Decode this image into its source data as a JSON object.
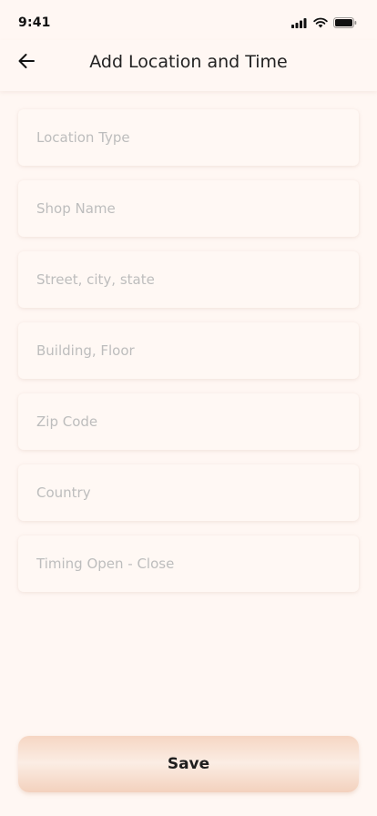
{
  "status_bar": {
    "time": "9:41",
    "icons": [
      "signal-icon",
      "wifi-icon",
      "battery-icon"
    ]
  },
  "header": {
    "title": "Add Location and Time",
    "back_icon": "arrow-left-icon"
  },
  "form": {
    "fields": [
      {
        "name": "location-type",
        "placeholder": "Location Type",
        "value": ""
      },
      {
        "name": "shop-name",
        "placeholder": "Shop Name",
        "value": ""
      },
      {
        "name": "street-city-state",
        "placeholder": "Street, city, state",
        "value": ""
      },
      {
        "name": "building-floor",
        "placeholder": "Building, Floor",
        "value": ""
      },
      {
        "name": "zip-code",
        "placeholder": "Zip Code",
        "value": ""
      },
      {
        "name": "country",
        "placeholder": "Country",
        "value": ""
      },
      {
        "name": "timing-open-close",
        "placeholder": "Timing Open - Close",
        "value": ""
      }
    ]
  },
  "actions": {
    "save_label": "Save"
  },
  "colors": {
    "background": "#FFF7F3",
    "field_background": "#FFF8F4",
    "placeholder": "#BDBDBD",
    "button_gradient_edge": "#F6D6C3",
    "button_gradient_center": "#FBEDE4"
  }
}
